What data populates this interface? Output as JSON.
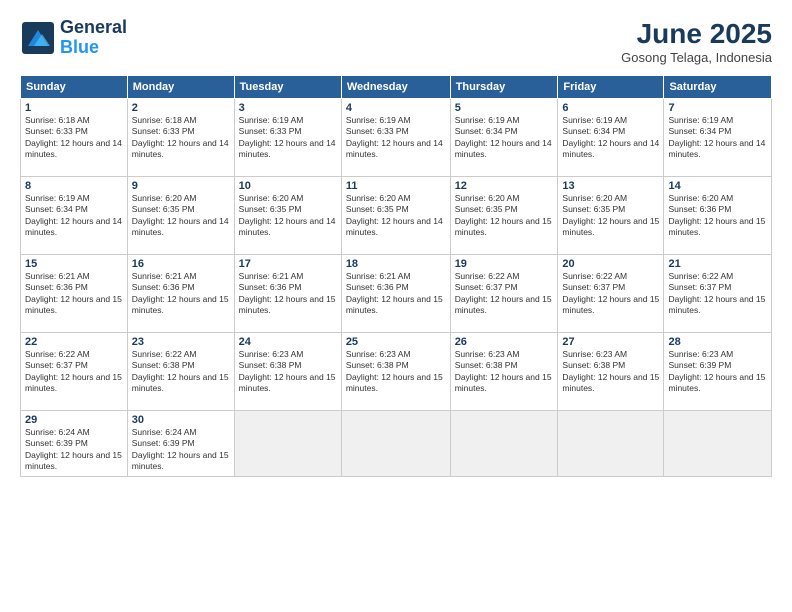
{
  "header": {
    "logo_line1": "General",
    "logo_line2": "Blue",
    "month": "June 2025",
    "location": "Gosong Telaga, Indonesia"
  },
  "days_of_week": [
    "Sunday",
    "Monday",
    "Tuesday",
    "Wednesday",
    "Thursday",
    "Friday",
    "Saturday"
  ],
  "weeks": [
    [
      {
        "day": "1",
        "sunrise": "6:18 AM",
        "sunset": "6:33 PM",
        "daylight": "12 hours and 14 minutes."
      },
      {
        "day": "2",
        "sunrise": "6:18 AM",
        "sunset": "6:33 PM",
        "daylight": "12 hours and 14 minutes."
      },
      {
        "day": "3",
        "sunrise": "6:19 AM",
        "sunset": "6:33 PM",
        "daylight": "12 hours and 14 minutes."
      },
      {
        "day": "4",
        "sunrise": "6:19 AM",
        "sunset": "6:33 PM",
        "daylight": "12 hours and 14 minutes."
      },
      {
        "day": "5",
        "sunrise": "6:19 AM",
        "sunset": "6:34 PM",
        "daylight": "12 hours and 14 minutes."
      },
      {
        "day": "6",
        "sunrise": "6:19 AM",
        "sunset": "6:34 PM",
        "daylight": "12 hours and 14 minutes."
      },
      {
        "day": "7",
        "sunrise": "6:19 AM",
        "sunset": "6:34 PM",
        "daylight": "12 hours and 14 minutes."
      }
    ],
    [
      {
        "day": "8",
        "sunrise": "6:19 AM",
        "sunset": "6:34 PM",
        "daylight": "12 hours and 14 minutes."
      },
      {
        "day": "9",
        "sunrise": "6:20 AM",
        "sunset": "6:35 PM",
        "daylight": "12 hours and 14 minutes."
      },
      {
        "day": "10",
        "sunrise": "6:20 AM",
        "sunset": "6:35 PM",
        "daylight": "12 hours and 14 minutes."
      },
      {
        "day": "11",
        "sunrise": "6:20 AM",
        "sunset": "6:35 PM",
        "daylight": "12 hours and 14 minutes."
      },
      {
        "day": "12",
        "sunrise": "6:20 AM",
        "sunset": "6:35 PM",
        "daylight": "12 hours and 15 minutes."
      },
      {
        "day": "13",
        "sunrise": "6:20 AM",
        "sunset": "6:35 PM",
        "daylight": "12 hours and 15 minutes."
      },
      {
        "day": "14",
        "sunrise": "6:20 AM",
        "sunset": "6:36 PM",
        "daylight": "12 hours and 15 minutes."
      }
    ],
    [
      {
        "day": "15",
        "sunrise": "6:21 AM",
        "sunset": "6:36 PM",
        "daylight": "12 hours and 15 minutes."
      },
      {
        "day": "16",
        "sunrise": "6:21 AM",
        "sunset": "6:36 PM",
        "daylight": "12 hours and 15 minutes."
      },
      {
        "day": "17",
        "sunrise": "6:21 AM",
        "sunset": "6:36 PM",
        "daylight": "12 hours and 15 minutes."
      },
      {
        "day": "18",
        "sunrise": "6:21 AM",
        "sunset": "6:36 PM",
        "daylight": "12 hours and 15 minutes."
      },
      {
        "day": "19",
        "sunrise": "6:22 AM",
        "sunset": "6:37 PM",
        "daylight": "12 hours and 15 minutes."
      },
      {
        "day": "20",
        "sunrise": "6:22 AM",
        "sunset": "6:37 PM",
        "daylight": "12 hours and 15 minutes."
      },
      {
        "day": "21",
        "sunrise": "6:22 AM",
        "sunset": "6:37 PM",
        "daylight": "12 hours and 15 minutes."
      }
    ],
    [
      {
        "day": "22",
        "sunrise": "6:22 AM",
        "sunset": "6:37 PM",
        "daylight": "12 hours and 15 minutes."
      },
      {
        "day": "23",
        "sunrise": "6:22 AM",
        "sunset": "6:38 PM",
        "daylight": "12 hours and 15 minutes."
      },
      {
        "day": "24",
        "sunrise": "6:23 AM",
        "sunset": "6:38 PM",
        "daylight": "12 hours and 15 minutes."
      },
      {
        "day": "25",
        "sunrise": "6:23 AM",
        "sunset": "6:38 PM",
        "daylight": "12 hours and 15 minutes."
      },
      {
        "day": "26",
        "sunrise": "6:23 AM",
        "sunset": "6:38 PM",
        "daylight": "12 hours and 15 minutes."
      },
      {
        "day": "27",
        "sunrise": "6:23 AM",
        "sunset": "6:38 PM",
        "daylight": "12 hours and 15 minutes."
      },
      {
        "day": "28",
        "sunrise": "6:23 AM",
        "sunset": "6:39 PM",
        "daylight": "12 hours and 15 minutes."
      }
    ],
    [
      {
        "day": "29",
        "sunrise": "6:24 AM",
        "sunset": "6:39 PM",
        "daylight": "12 hours and 15 minutes."
      },
      {
        "day": "30",
        "sunrise": "6:24 AM",
        "sunset": "6:39 PM",
        "daylight": "12 hours and 15 minutes."
      },
      null,
      null,
      null,
      null,
      null
    ]
  ]
}
